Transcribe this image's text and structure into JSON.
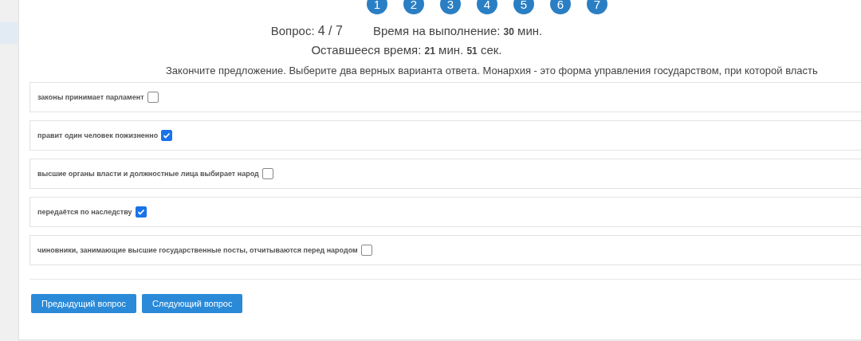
{
  "question_nav": [
    {
      "label": "1"
    },
    {
      "label": "2"
    },
    {
      "label": "3"
    },
    {
      "label": "4"
    },
    {
      "label": "5"
    },
    {
      "label": "6"
    },
    {
      "label": "7"
    }
  ],
  "question_counter": {
    "label": "Вопрос:",
    "value": "4 / 7"
  },
  "time_limit": {
    "label": "Время на выполнение:",
    "value": "30",
    "unit": "мин."
  },
  "time_left": {
    "label": "Оставшееся время:",
    "minutes": "21",
    "minutes_unit": "мин.",
    "seconds": "51",
    "seconds_unit": "сек."
  },
  "question": "Закончите предложение. Выберите два верных варианта ответа. Монархия - это форма управления государством, при которой власть",
  "options": [
    {
      "text": "законы принимает парламент",
      "checked": false
    },
    {
      "text": "правит один человек пожизненно",
      "checked": true
    },
    {
      "text": "высшие органы власти и должностные лица выбирает народ",
      "checked": false
    },
    {
      "text": "передаётся по наследству",
      "checked": true
    },
    {
      "text": "чиновники, занимающие высшие государственные посты, отчитываются перед народом",
      "checked": false
    }
  ],
  "buttons": [
    {
      "label": "Предыдущий вопрос"
    },
    {
      "label": "Следующий вопрос"
    }
  ]
}
